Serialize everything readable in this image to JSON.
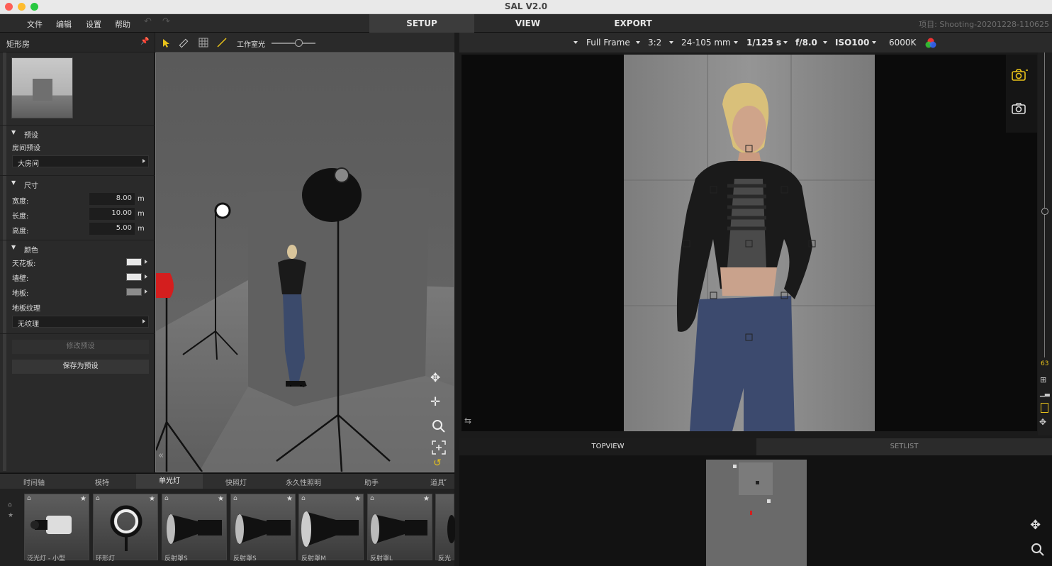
{
  "window": {
    "title": "SAL V2.0"
  },
  "menu": {
    "file": "文件",
    "edit": "编辑",
    "settings": "设置",
    "help": "帮助"
  },
  "tabs": {
    "setup": "SETUP",
    "view": "VIEW",
    "export": "EXPORT"
  },
  "project": "项目: Shooting-20201228-110625",
  "left_panel": {
    "title": "矩形房",
    "presets": {
      "section": "预设",
      "room_preset_label": "房间预设",
      "room_preset_value": "大房间"
    },
    "size": {
      "section": "尺寸",
      "width_label": "宽度:",
      "width_value": "8.00",
      "length_label": "长度:",
      "length_value": "10.00",
      "height_label": "高度:",
      "height_value": "5.00",
      "unit": "m"
    },
    "color": {
      "section": "颜色",
      "ceiling_label": "天花板:",
      "ceiling_color": "#e8e8e8",
      "wall_label": "墙壁:",
      "wall_color": "#e8e8e8",
      "floor_label": "地板:",
      "floor_color": "#8c8c8c",
      "floor_texture_label": "地板纹理",
      "floor_texture_value": "无纹理"
    },
    "modify_preset": "修改预设",
    "save_preset": "保存为预设"
  },
  "viewport_toolbar": {
    "work_light_label": "工作室光",
    "work_light_level": 0.6
  },
  "camera_settings": {
    "sensor": "Full Frame",
    "ratio": "3:2",
    "lens": "24-105 mm",
    "shutter": "1/125 s",
    "aperture": "f/8.0",
    "iso": "ISO100",
    "white_balance": "6000K"
  },
  "right_bar": {
    "value": "63"
  },
  "bottom_tabs": {
    "topview": "TOPVIEW",
    "setlist": "SETLIST"
  },
  "library": {
    "tabs": [
      "时间轴",
      "模特",
      "单光灯",
      "快照灯",
      "永久性照明",
      "助手",
      "道具"
    ],
    "active_tab": "单光灯",
    "items": [
      {
        "caption": "泛光灯 - 小型"
      },
      {
        "caption": "环形灯"
      },
      {
        "caption": "反射罩S"
      },
      {
        "caption": "反射罩S"
      },
      {
        "caption": "反射罩M"
      },
      {
        "caption": "反射罩L"
      },
      {
        "caption": "反光"
      }
    ]
  },
  "colors": {
    "accent_yellow": "#e8c21a",
    "light_red": "#d41e1e"
  }
}
